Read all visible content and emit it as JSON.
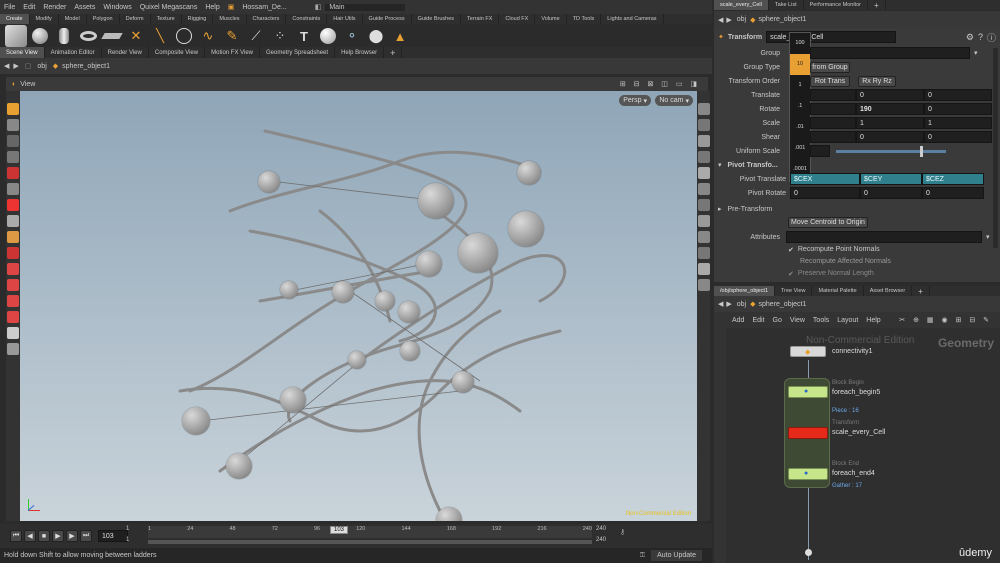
{
  "menu": [
    "File",
    "Edit",
    "Render",
    "Assets",
    "Windows",
    "Quixel Megascans",
    "Help"
  ],
  "desktop_tab": "Hossam_De...",
  "desktop_name": "Main",
  "shelf_tabs": [
    "Create",
    "Modify",
    "Model",
    "Polygon",
    "Deform",
    "Texture",
    "Rigging",
    "Muscles",
    "Characters",
    "Constraints",
    "Hair Utils",
    "Guide Process",
    "Guide Brushes",
    "Terrain FX",
    "Cloud FX",
    "Volume",
    "TD Tools",
    "Lights and Cameras"
  ],
  "pane_tabs": [
    "Scene View",
    "Animation Editor",
    "Render View",
    "Composite View",
    "Motion FX View",
    "Geometry Spreadsheet",
    "Help Browser"
  ],
  "path": {
    "obj": "obj",
    "object": "sphere_object1"
  },
  "viewport": {
    "label": "View",
    "persp": "Persp",
    "cam": "No cam",
    "watermark": "Non-Commercial Edition"
  },
  "timeline": {
    "frame": "103",
    "current": "103",
    "ticks": [
      "1",
      "24",
      "48",
      "72",
      "96",
      "120",
      "144",
      "168",
      "192",
      "216",
      "240"
    ],
    "start": "1",
    "start2": "1",
    "end": "240",
    "end2": "240",
    "auto_update": "Auto Update"
  },
  "status_text": "Hold down Shift to allow moving between ladders",
  "right_tabs": [
    "scale_every_Cell",
    "Take List",
    "Performance Monitor"
  ],
  "params": {
    "type": "Transform",
    "name": "scale_every_Cell",
    "group_label": "Group",
    "group_type_label": "Group Type",
    "group_type_value": "from Group",
    "order_label": "Transform Order",
    "order_value": "Rot Trans",
    "order_value2": "Rx Ry Rz",
    "translate_label": "Translate",
    "translate": [
      "0",
      "0"
    ],
    "rotate_label": "Rotate",
    "rotate": [
      "190",
      "0"
    ],
    "scale_label": "Scale",
    "scale": [
      "1",
      "1"
    ],
    "shear_label": "Shear",
    "shear": [
      "0",
      "0"
    ],
    "uniform_label": "Uniform Scale",
    "pivot_section": "Pivot Transfo...",
    "pivot_translate_label": "Pivot Translate",
    "pivot_translate": [
      "$CEX",
      "$CEY",
      "$CEZ"
    ],
    "pivot_rotate_label": "Pivot Rotate",
    "pivot_rotate": [
      "0",
      "0",
      "0"
    ],
    "pre_section": "Pre-Transform",
    "centroid_button": "Move Centroid to Origin",
    "attributes_label": "Attributes",
    "recompute_points": "Recompute Point Normals",
    "recompute_affected": "Recompute Affected Normals",
    "preserve_length": "Preserve Normal Length"
  },
  "ladder": [
    "100",
    "10",
    "1",
    ".1",
    ".01",
    ".001",
    ".0001"
  ],
  "network_tabs": [
    "/obj/sphere_object1",
    "Tree View",
    "Material Palette",
    "Asset Browser"
  ],
  "network_menu": [
    "Add",
    "Edit",
    "Go",
    "View",
    "Tools",
    "Layout",
    "Help"
  ],
  "network": {
    "watermark": "Non-Commercial Edition",
    "context": "Geometry",
    "connectivity": "connectivity1",
    "begin_type": "Block Begin",
    "begin_name": "foreach_begin5",
    "begin_info": "Piece : 16",
    "transform_type": "Transform",
    "transform_name": "scale_every_Cell",
    "end_type": "Block End",
    "end_name": "foreach_end4",
    "end_info": "Gather : 17"
  },
  "brand": "ûdemy",
  "colors": {
    "accent": "#e8a033",
    "transform_node": "#e62a1a",
    "block_node": "#c7e58a",
    "viewport_top": "#8fa6b8",
    "viewport_bottom": "#c9d3da"
  }
}
